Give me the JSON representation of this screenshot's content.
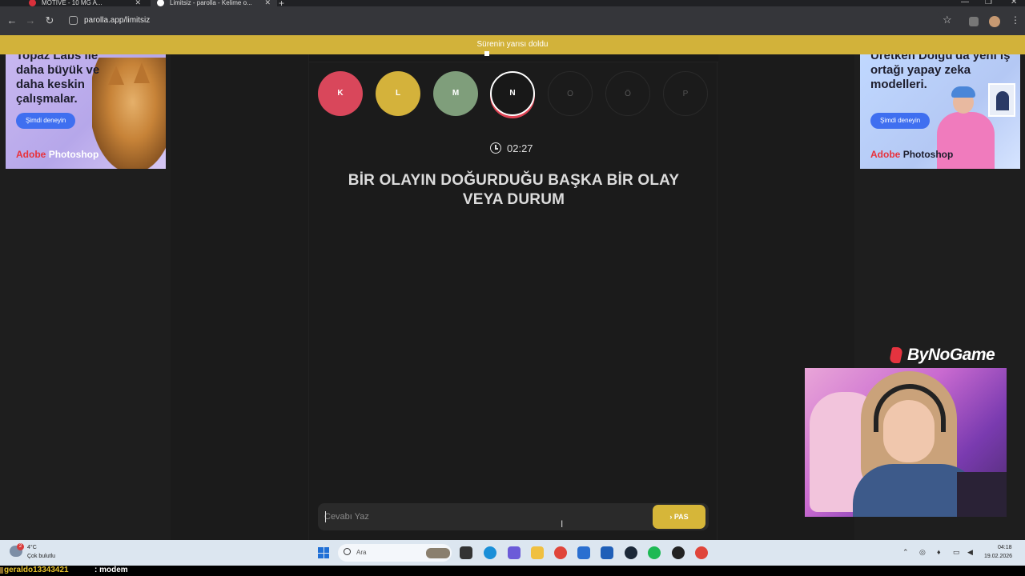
{
  "browser": {
    "tabs": [
      {
        "title": "MOTIVE - 10 MG A...",
        "active": false
      },
      {
        "title": "Limitsiz - parolla - Kelime o...",
        "active": true
      }
    ],
    "url": "parolla.app/limitsiz"
  },
  "notice": "Sürenin yarısı doldu",
  "ads": {
    "left": {
      "headline": "Topaz Labs ile daha büyük ve daha keskin çalışmalar.",
      "cta": "Şimdi deneyin",
      "brand_a": "Adobe",
      "brand_b": "Photoshop"
    },
    "right": {
      "headline": "Üretken Dolgu'da yeni iş ortağı yapay zeka modelleri.",
      "cta": "Şimdi deneyin",
      "brand_a": "Adobe",
      "brand_b": "Photoshop"
    }
  },
  "game": {
    "letters": [
      {
        "letter": "K",
        "state": "wrong",
        "color": "#d9475b"
      },
      {
        "letter": "L",
        "state": "passed",
        "color": "#d4b23b"
      },
      {
        "letter": "M",
        "state": "correct",
        "color": "#7f9e7b"
      },
      {
        "letter": "N",
        "state": "current",
        "color": "#181818"
      },
      {
        "letter": "O",
        "state": "pending"
      },
      {
        "letter": "Ö",
        "state": "pending"
      },
      {
        "letter": "P",
        "state": "pending"
      }
    ],
    "timer": "02:27",
    "question": "BİR OLAYIN DOĞURDUĞU BAŞKA BİR OLAY VEYA DURUM",
    "answer_placeholder": "Cevabı Yaz",
    "answer_value": "",
    "pass_label": "PAS",
    "pass_icon": "chevron-right-icon"
  },
  "overlay": {
    "logo": "ByNoGame"
  },
  "taskbar": {
    "weather_temp": "4°C",
    "weather_desc": "Çok bulutlu",
    "weather_badge": "2",
    "search_label": "Ara",
    "time": "04:18",
    "date": "19.02.2026"
  },
  "chat": {
    "user": "geraldo13343421",
    "message": ": modem"
  },
  "colors": {
    "accent": "#d6b639",
    "notice_bg": "#d2b23a",
    "bg": "#1b1b1b"
  }
}
